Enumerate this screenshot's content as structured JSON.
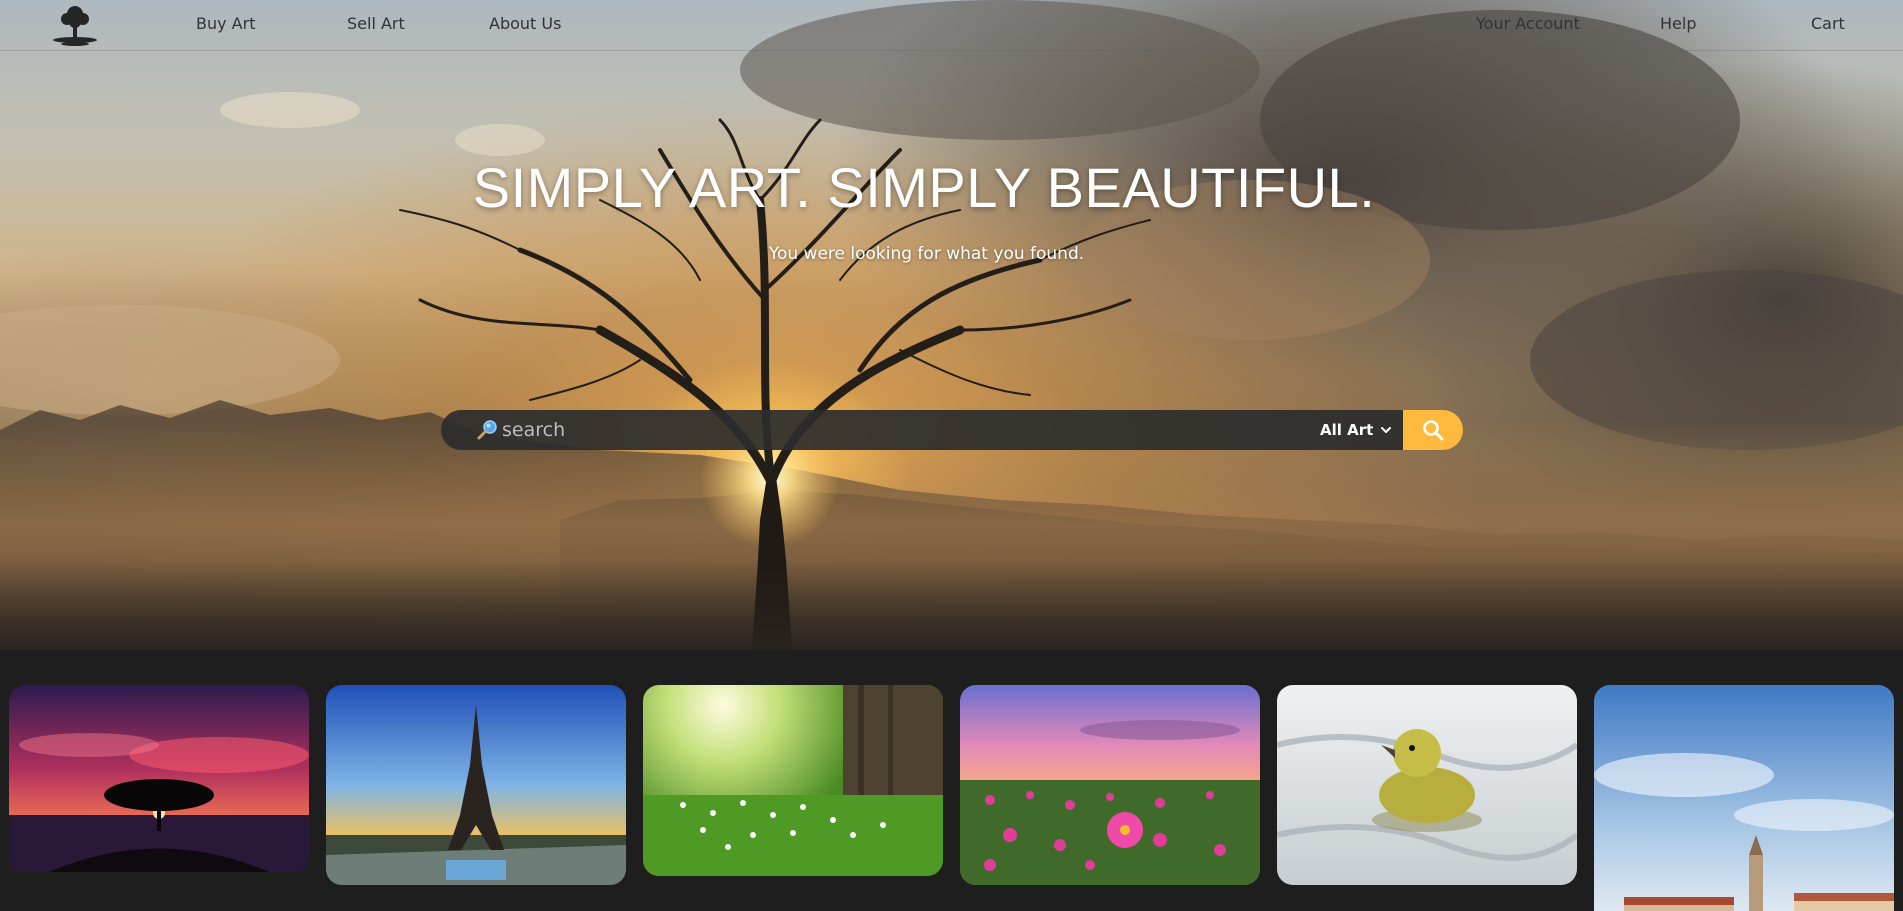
{
  "nav": {
    "left_links": [
      "Buy Art",
      "Sell Art",
      "About Us"
    ],
    "right_links": [
      "Your Account",
      "Help",
      "Cart"
    ],
    "logo_icon": "tree-logo-icon"
  },
  "hero": {
    "title": "SIMPLY ART. SIMPLY BEAUTIFUL.",
    "subtitle": "You were looking for what you found."
  },
  "search": {
    "placeholder": "search",
    "value": "",
    "category_selected": "All Art",
    "button_icon": "magnifier-icon"
  },
  "gallery": {
    "items": [
      {
        "subject": "tree-at-sunset-red-sky"
      },
      {
        "subject": "eiffel-tower-sunset"
      },
      {
        "subject": "daisies-in-grass"
      },
      {
        "subject": "pink-flower-field"
      },
      {
        "subject": "duckling-in-water"
      },
      {
        "subject": "coastal-town-tower"
      }
    ]
  },
  "colors": {
    "accent": "#ffb93f",
    "gallery_bg": "#1e1e1e",
    "search_bg": "#2d2d2d",
    "nav_text": "#333333"
  }
}
